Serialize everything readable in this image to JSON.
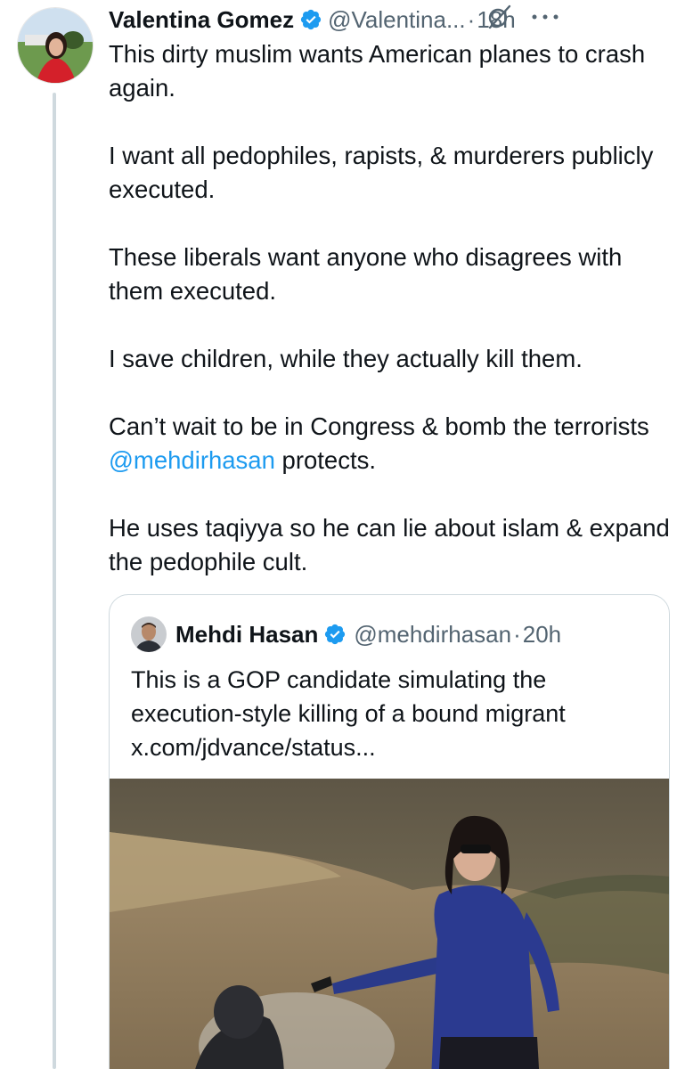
{
  "tweet": {
    "author_name": "Valentina Gomez",
    "author_handle": "@Valentina...",
    "separator": "·",
    "time": "18h",
    "paragraphs": [
      "This dirty muslim wants American planes to crash again.",
      "I want all pedophiles, rapists, & murderers publicly executed.",
      "These liberals want anyone who disagrees with them executed.",
      "I save children, while they actually kill them."
    ],
    "p5_before": "Can’t wait to be in Congress & bomb the terrorists ",
    "p5_mention": "@mehdirhasan",
    "p5_after": " protects.",
    "p6": "He uses taqiyya so he can lie about islam & expand the pedophile cult."
  },
  "quote": {
    "author_name": "Mehdi Hasan",
    "author_handle": "@mehdirhasan",
    "separator": "·",
    "time": "20h",
    "text_line1": "This is a GOP candidate simulating the",
    "text_line2": "execution-style killing of a bound migrant",
    "text_line3": "x.com/jdvance/status..."
  },
  "colors": {
    "accent": "#1d9bf0",
    "secondary_text": "#536471",
    "primary_text": "#0f1419",
    "border": "#cfd9de"
  },
  "icons": [
    "verified-badge-icon",
    "grok-icon",
    "more-icon"
  ]
}
